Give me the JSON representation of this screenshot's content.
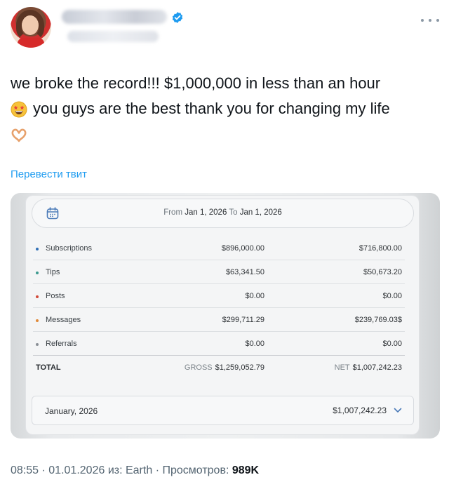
{
  "tweet": {
    "text_line1": "we broke the record!!! $1,000,000 in less than an hour",
    "text_line2": "you guys are the best thank you for changing my life",
    "emoji_1": "star-struck-face",
    "emoji_2": "heart-hands",
    "translate_label": "Перевести твит",
    "time": "08:55",
    "date": "01.01.2026",
    "source_label": "из:",
    "source": "Earth",
    "views_label": "Просмотров:",
    "views": "989K",
    "sep": "·"
  },
  "colors": {
    "link": "#1d9bf0",
    "verified": "#1d9bf0",
    "subscriptions_dot": "#2f6fb5",
    "tips_dot": "#3c9a8f",
    "posts_dot": "#d24a3a",
    "messages_dot": "#e08a3a",
    "referrals_dot": "#8a8f96"
  },
  "statement": {
    "from_label": "From",
    "from_date": "Jan 1, 2026",
    "to_label": "To",
    "to_date": "Jan 1, 2026",
    "rows": [
      {
        "label": "Subscriptions",
        "gross": "$896,000.00",
        "net": "$716,800.00"
      },
      {
        "label": "Tips",
        "gross": "$63,341.50",
        "net": "$50,673.20"
      },
      {
        "label": "Posts",
        "gross": "$0.00",
        "net": "$0.00"
      },
      {
        "label": "Messages",
        "gross": "$299,711.29",
        "net": "$239,769.03$"
      },
      {
        "label": "Referrals",
        "gross": "$0.00",
        "net": "$0.00"
      }
    ],
    "total_label": "TOTAL",
    "gross_label": "GROSS",
    "gross_total": "$1,259,052.79",
    "net_label": "NET",
    "net_total": "$1,007,242.23",
    "month": "January, 2026",
    "month_amount": "$1,007,242.23"
  }
}
